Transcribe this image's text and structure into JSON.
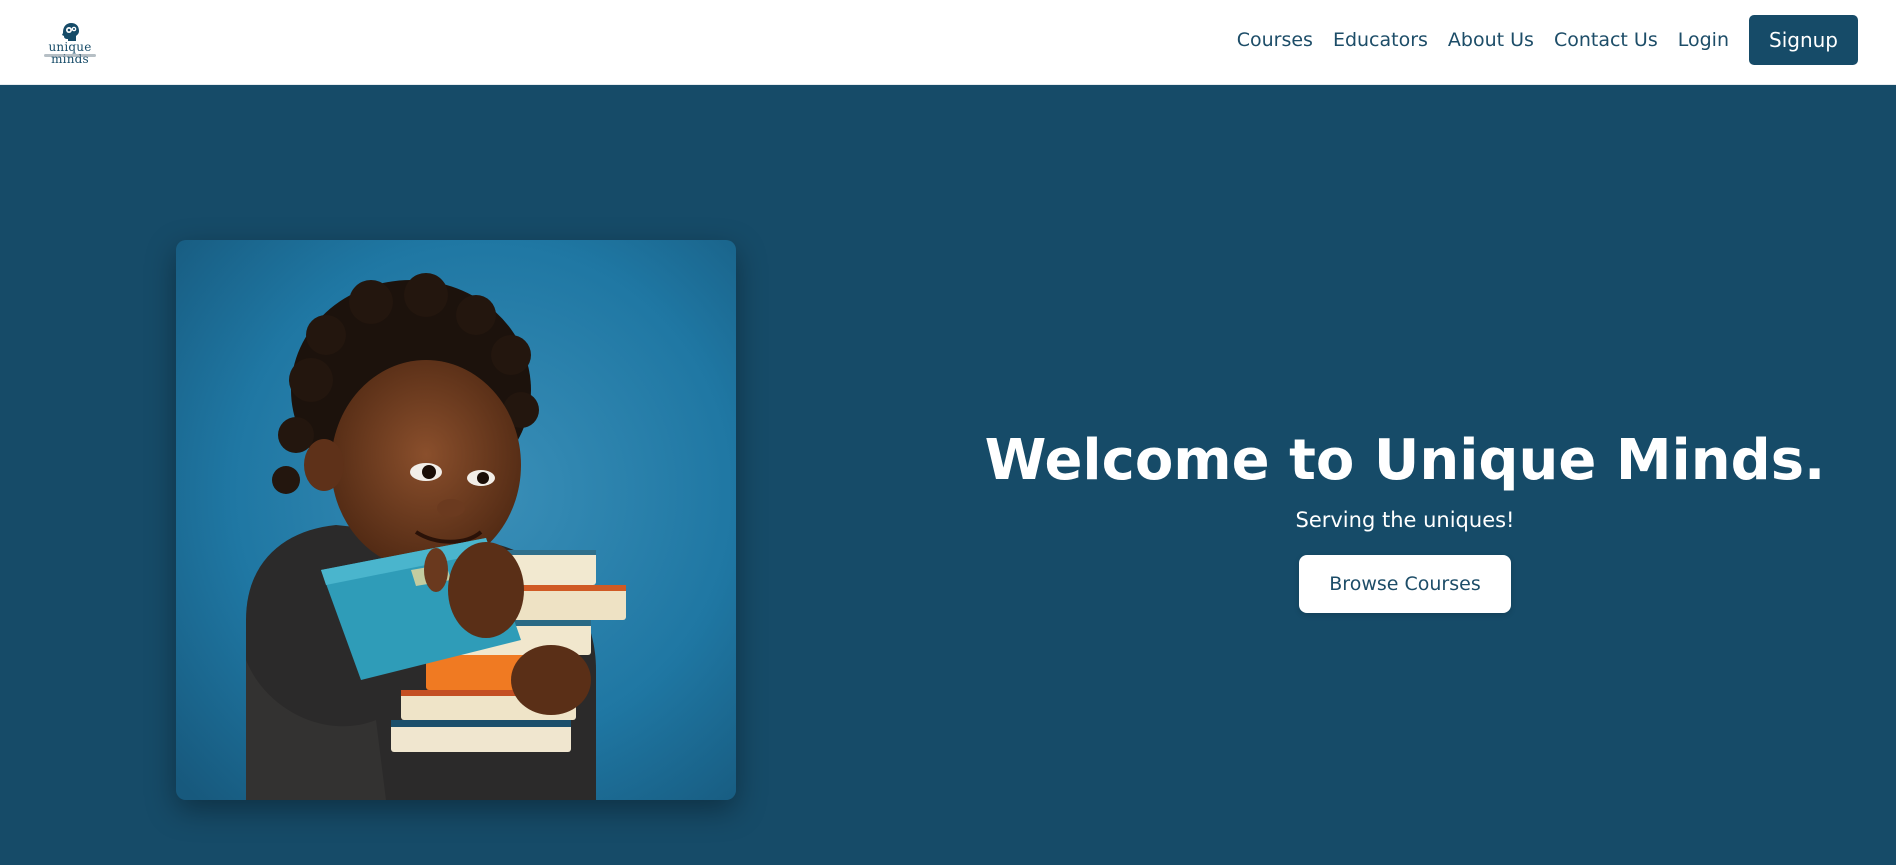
{
  "brand": {
    "logo_text": "unique minds",
    "logo_icon": "brain-head-icon",
    "primary_color": "#164b68"
  },
  "nav": {
    "links": [
      "Courses",
      "Educators",
      "About Us",
      "Contact Us",
      "Login"
    ],
    "signup_label": "Signup"
  },
  "hero": {
    "title": "Welcome to Unique Minds.",
    "subtitle": "Serving the uniques!",
    "cta_label": "Browse Courses",
    "background_color": "#164b68",
    "image_icon": "child-with-books-image"
  }
}
